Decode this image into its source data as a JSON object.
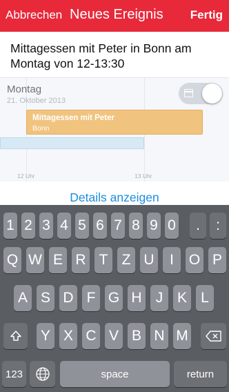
{
  "header": {
    "cancel_label": "Abbrechen",
    "title": "Neues Ereignis",
    "done_label": "Fertig"
  },
  "input": {
    "text": "Mittagessen mit Peter in Bonn am Montag von 12-13:30"
  },
  "calendar": {
    "day_label": "Montag",
    "date_label": "21. Oktober 2013",
    "event_title": "Mittagessen mit Peter",
    "event_location": "Bonn",
    "ticks": [
      "12 Uhr",
      "13 Uhr"
    ],
    "toggle_icon": "calendar-icon"
  },
  "details_label": "Details anzeigen",
  "keyboard": {
    "row1": [
      "1",
      "2",
      "3",
      "4",
      "5",
      "6",
      "7",
      "8",
      "9",
      "0",
      ".",
      ":"
    ],
    "row2": [
      "Q",
      "W",
      "E",
      "R",
      "T",
      "Z",
      "U",
      "I",
      "O",
      "P"
    ],
    "row3": [
      "A",
      "S",
      "D",
      "F",
      "G",
      "H",
      "J",
      "K",
      "L"
    ],
    "row4": [
      "Y",
      "X",
      "C",
      "V",
      "B",
      "N",
      "M"
    ],
    "shift_icon": "shift-icon",
    "backspace_icon": "backspace-icon",
    "numbers_label": "123",
    "globe_icon": "globe-icon",
    "space_label": "space",
    "return_label": "return"
  },
  "colors": {
    "accent": "#e7293a",
    "link": "#1b8ede",
    "event": "#f0c37f"
  }
}
